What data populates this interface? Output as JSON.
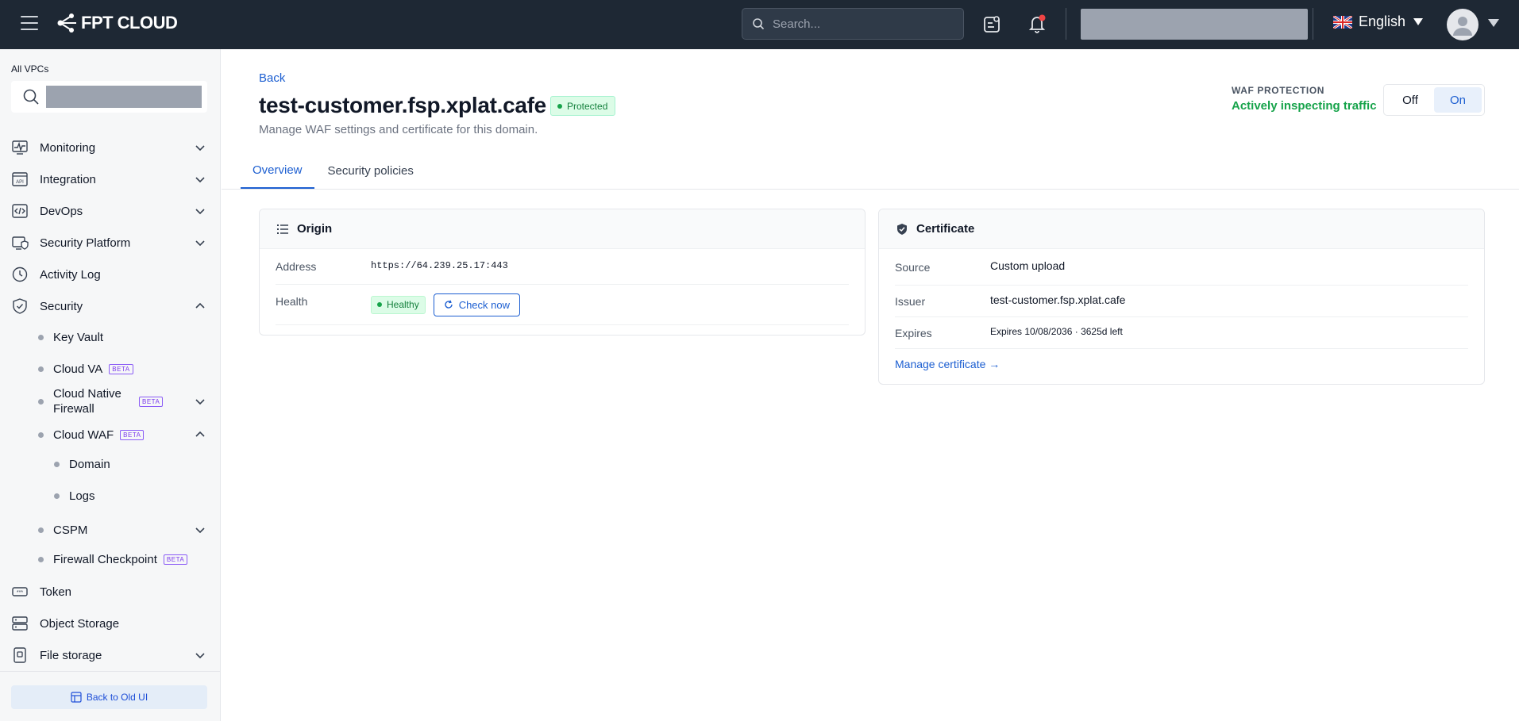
{
  "topbar": {
    "brand": "FPT CLOUD",
    "search_placeholder": "Search...",
    "language": "English"
  },
  "sidebar": {
    "vpc_label": "All VPCs",
    "items": [
      {
        "label": "Monitoring",
        "icon": "monitoring-icon",
        "expandable": true,
        "expanded": false
      },
      {
        "label": "Integration",
        "icon": "api-icon",
        "expandable": true,
        "expanded": false
      },
      {
        "label": "DevOps",
        "icon": "code-icon",
        "expandable": true,
        "expanded": false
      },
      {
        "label": "Security Platform",
        "icon": "security-platform-icon",
        "expandable": true,
        "expanded": false
      },
      {
        "label": "Activity Log",
        "icon": "clock-icon",
        "expandable": false
      },
      {
        "label": "Security",
        "icon": "shield-icon",
        "expandable": true,
        "expanded": true
      },
      {
        "label": "Token",
        "icon": "token-icon",
        "expandable": false
      },
      {
        "label": "Object Storage",
        "icon": "storage-icon",
        "expandable": false
      },
      {
        "label": "File storage",
        "icon": "file-storage-icon",
        "expandable": true,
        "expanded": false
      }
    ],
    "security_children": [
      {
        "label": "Key Vault"
      },
      {
        "label": "Cloud VA",
        "badge": "BETA"
      },
      {
        "label": "Cloud Native Firewall",
        "badge": "BETA"
      },
      {
        "label": "Cloud WAF",
        "badge": "BETA"
      },
      {
        "label": "CSPM"
      },
      {
        "label": "Firewall Checkpoint",
        "badge": "BETA"
      }
    ],
    "waf_children": [
      {
        "label": "Domain"
      },
      {
        "label": "Logs"
      }
    ],
    "back_old_ui": "Back to Old UI"
  },
  "page": {
    "back": "Back",
    "title": "test-customer.fsp.xplat.cafe",
    "status_badge": "Protected",
    "subtitle": "Manage WAF settings and certificate for this domain.",
    "waf_protection_label": "WAF PROTECTION",
    "waf_protection_status": "Actively inspecting traffic",
    "toggle_off": "Off",
    "toggle_on": "On",
    "toggle_value": "On",
    "tabs": [
      {
        "label": "Overview",
        "active": true
      },
      {
        "label": "Security policies",
        "active": false
      }
    ]
  },
  "origin": {
    "title": "Origin",
    "address_label": "Address",
    "address_value": "https://64.239.25.17:443",
    "health_label": "Health",
    "health_value": "Healthy",
    "check_now": "Check now"
  },
  "certificate": {
    "title": "Certificate",
    "source_label": "Source",
    "source_value": "Custom upload",
    "issuer_label": "Issuer",
    "issuer_value": "test-customer.fsp.xplat.cafe",
    "expires_label": "Expires",
    "expires_value": "Expires 10/08/2036 · 3625d left",
    "manage_link": "Manage certificate →"
  },
  "colors": {
    "topbar_bg": "#1e2834",
    "accent": "#1d5fd1",
    "success": "#16a34a",
    "beta": "#7c3aed"
  }
}
